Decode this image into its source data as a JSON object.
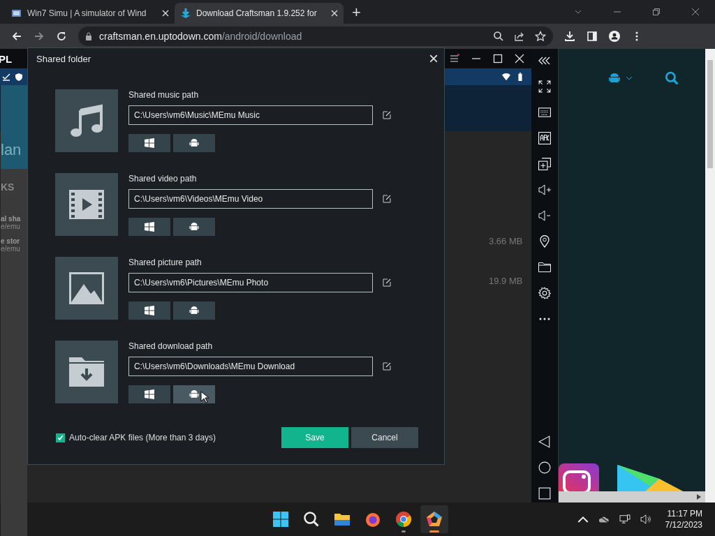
{
  "browser": {
    "tabs": [
      {
        "title": "Win7 Simu | A simulator of Wind",
        "selected": false
      },
      {
        "title": "Download Craftsman 1.9.252 for",
        "selected": true
      }
    ],
    "new_tab": "+",
    "address": {
      "domain": "craftsman.en.uptodown.com",
      "path": "/android/download"
    }
  },
  "background_page": {
    "logo": "PL",
    "heading": "lan",
    "section": "KS",
    "lines": [
      "al sha",
      "e/emu",
      "e stor",
      "e/emu"
    ],
    "sizes": [
      "3.66 MB",
      "19.9 MB"
    ]
  },
  "dialog": {
    "title": "Shared folder",
    "close": "×",
    "items": [
      {
        "kind": "music",
        "label": "Shared music path",
        "path": "C:\\Users\\vm6\\Music\\MEmu Music"
      },
      {
        "kind": "video",
        "label": "Shared video path",
        "path": "C:\\Users\\vm6\\Videos\\MEmu Video"
      },
      {
        "kind": "picture",
        "label": "Shared picture path",
        "path": "C:\\Users\\vm6\\Pictures\\MEmu Photo"
      },
      {
        "kind": "download",
        "label": "Shared download path",
        "path": "C:\\Users\\vm6\\Downloads\\MEmu Download"
      }
    ],
    "auto_clear": {
      "label": "Auto-clear APK files (More than 3 days)",
      "checked": true
    },
    "buttons": [
      {
        "kind": "primary",
        "label": "Save"
      },
      {
        "kind": "secondary",
        "label": "Cancel"
      }
    ]
  },
  "taskbar": {
    "apps": [
      {
        "kind": "start",
        "running": false,
        "active": false
      },
      {
        "kind": "search",
        "running": false,
        "active": false
      },
      {
        "kind": "files",
        "running": false,
        "active": false
      },
      {
        "kind": "firefox",
        "running": false,
        "active": false
      },
      {
        "kind": "chrome",
        "running": true,
        "active": false
      },
      {
        "kind": "memu",
        "running": true,
        "active": true
      }
    ],
    "time": "11:17 PM",
    "date": "7/12/2023"
  }
}
